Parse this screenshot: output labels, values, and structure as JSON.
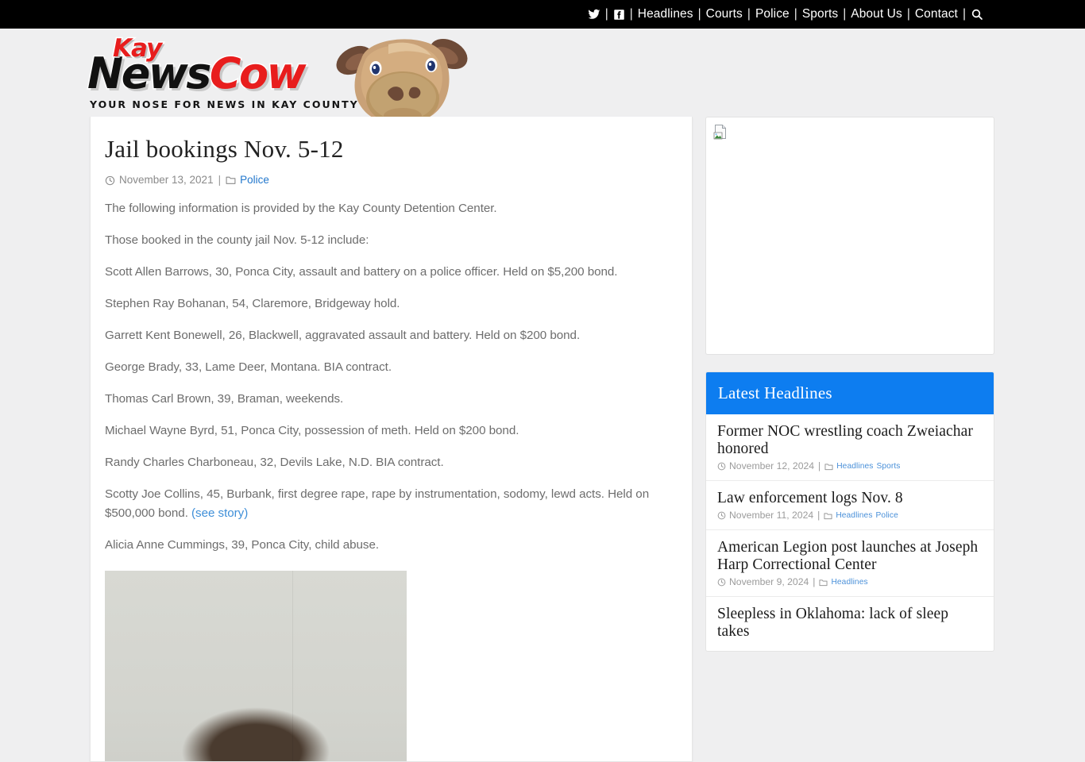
{
  "topnav": {
    "social": [
      {
        "icon": "twitter-icon",
        "name": "Twitter"
      },
      {
        "icon": "facebook-icon",
        "name": "Facebook"
      }
    ],
    "separator": "|",
    "links": [
      {
        "label": "Headlines"
      },
      {
        "label": "Courts"
      },
      {
        "label": "Police"
      },
      {
        "label": "Sports"
      },
      {
        "label": "About Us"
      },
      {
        "label": "Contact"
      }
    ],
    "search_icon": "search-icon"
  },
  "logo": {
    "kay": "Kay",
    "news": "News",
    "cow": "Cow",
    "tagline": "YOUR NOSE FOR NEWS IN KAY COUNTY",
    "mascot": "cow-head-graphic",
    "colors": {
      "red": "#e81d1d",
      "black": "#111111"
    }
  },
  "article": {
    "title": "Jail bookings Nov. 5-12",
    "date": "November 13, 2021",
    "meta_separator": "|",
    "category": "Police",
    "clock_icon": "clock-icon",
    "folder_icon": "folder-icon",
    "paragraphs": [
      {
        "text": "The following information is provided by the Kay County Detention Center."
      },
      {
        "text": "Those booked in the county jail Nov. 5-12 include:"
      },
      {
        "text": "Scott Allen Barrows, 30, Ponca City, assault and battery on a police officer. Held on $5,200 bond."
      },
      {
        "text": "Stephen Ray Bohanan, 54, Claremore, Bridgeway hold."
      },
      {
        "text": "Garrett Kent Bonewell, 26, Blackwell, aggravated assault and battery. Held on $200 bond."
      },
      {
        "text": "George Brady, 33, Lame Deer, Montana. BIA contract."
      },
      {
        "text": "Thomas Carl Brown, 39, Braman, weekends."
      },
      {
        "text": "Michael Wayne Byrd, 51, Ponca City, possession of meth. Held on $200 bond."
      },
      {
        "text": "Randy Charles Charboneau, 32, Devils Lake, N.D. BIA contract."
      },
      {
        "text": "Scotty Joe Collins, 45, Burbank, first degree rape, rape by instrumentation, sodomy, lewd acts. Held on $500,000 bond. ",
        "link": "(see story)"
      },
      {
        "text": "Alicia Anne Cummings, 39, Ponca City, child abuse."
      }
    ],
    "image": "mugshot-photo"
  },
  "sidebar": {
    "ad": {
      "name": "advertisement-placeholder",
      "icon": "broken-image-icon"
    },
    "headlines_widget": {
      "title": "Latest Headlines",
      "accent_color": "#0d7df0",
      "clock_icon": "clock-icon",
      "folder_icon": "folder-icon",
      "meta_separator": "|",
      "items": [
        {
          "title": "Former NOC wrestling coach Zweiachar honored",
          "date": "November 12, 2024",
          "categories": [
            "Headlines",
            "Sports"
          ]
        },
        {
          "title": "Law enforcement logs Nov. 8",
          "date": "November 11, 2024",
          "categories": [
            "Headlines",
            "Police"
          ]
        },
        {
          "title": "American Legion post launches at Joseph Harp Correctional Center",
          "date": "November 9, 2024",
          "categories": [
            "Headlines"
          ]
        },
        {
          "title": "Sleepless in Oklahoma: lack of sleep takes",
          "date": "",
          "categories": []
        }
      ]
    }
  }
}
